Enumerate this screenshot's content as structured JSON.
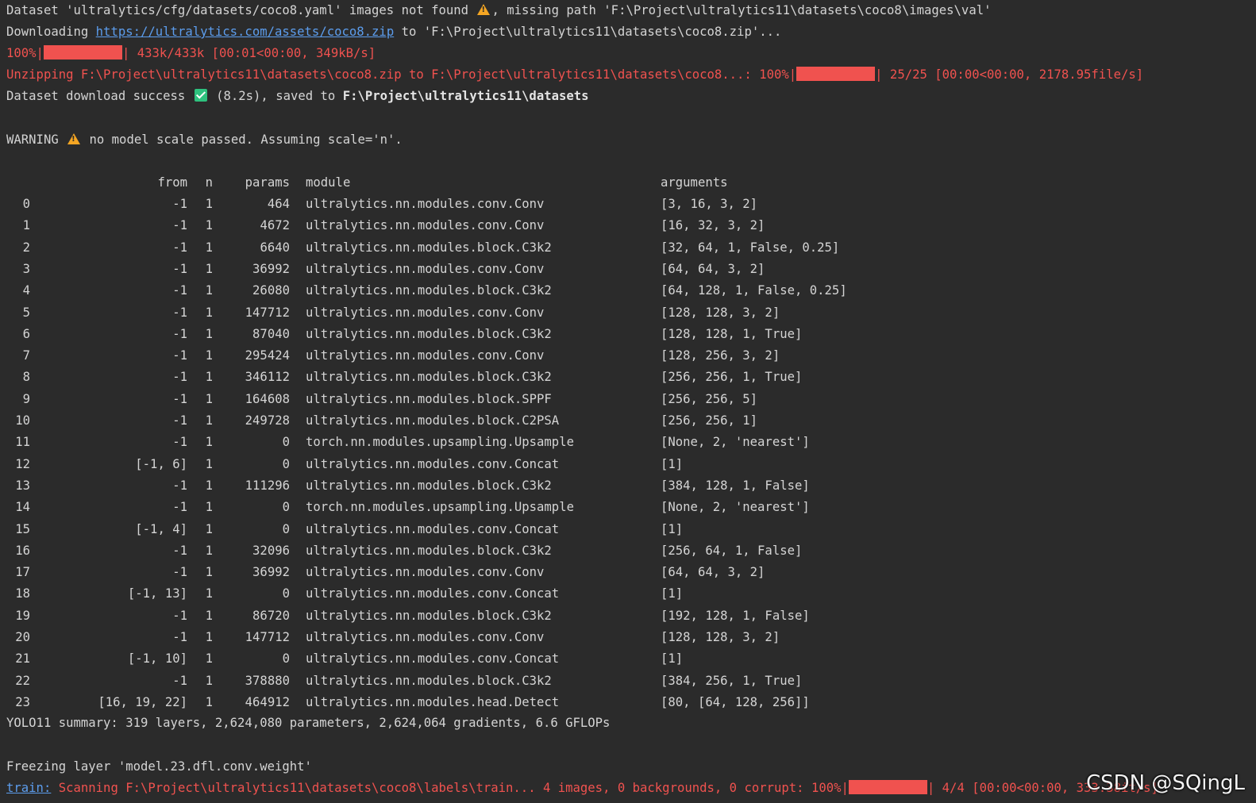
{
  "log": {
    "l1_a": "Dataset 'ultralytics/cfg/datasets/coco8.yaml' images not found ",
    "l1_icon": "warning-icon",
    "l1_b": ", missing path 'F:\\Project\\ultralytics11\\datasets\\coco8\\images\\val'",
    "l2_a": "Downloading ",
    "l2_link": "https://ultralytics.com/assets/coco8.zip",
    "l2_b": " to 'F:\\Project\\ultralytics11\\datasets\\coco8.zip'...",
    "l3_a": "100%|",
    "l3_progress": 100,
    "l3_b": "| 433k/433k [00:01<00:00, 349kB/s]",
    "l4_a": "Unzipping F:\\Project\\ultralytics11\\datasets\\coco8.zip to F:\\Project\\ultralytics11\\datasets\\coco8...: 100%|",
    "l4_progress": 100,
    "l4_b": "| 25/25 [00:00<00:00, 2178.95file/s]",
    "l5_a": "Dataset download success ",
    "l5_icon": "check-icon",
    "l5_b": " (8.2s), saved to ",
    "l5_path": "F:\\Project\\ultralytics11\\datasets",
    "l6_a": "WARNING ",
    "l6_icon": "warning-icon",
    "l6_b": " no model scale passed. Assuming scale='n'."
  },
  "table": {
    "headers": {
      "from": "from",
      "n": "n",
      "params": "params",
      "module": "module",
      "arguments": "arguments"
    },
    "rows": [
      {
        "idx": "0",
        "from": "-1",
        "n": "1",
        "params": "464",
        "module": "ultralytics.nn.modules.conv.Conv",
        "args": "[3, 16, 3, 2]"
      },
      {
        "idx": "1",
        "from": "-1",
        "n": "1",
        "params": "4672",
        "module": "ultralytics.nn.modules.conv.Conv",
        "args": "[16, 32, 3, 2]"
      },
      {
        "idx": "2",
        "from": "-1",
        "n": "1",
        "params": "6640",
        "module": "ultralytics.nn.modules.block.C3k2",
        "args": "[32, 64, 1, False, 0.25]"
      },
      {
        "idx": "3",
        "from": "-1",
        "n": "1",
        "params": "36992",
        "module": "ultralytics.nn.modules.conv.Conv",
        "args": "[64, 64, 3, 2]"
      },
      {
        "idx": "4",
        "from": "-1",
        "n": "1",
        "params": "26080",
        "module": "ultralytics.nn.modules.block.C3k2",
        "args": "[64, 128, 1, False, 0.25]"
      },
      {
        "idx": "5",
        "from": "-1",
        "n": "1",
        "params": "147712",
        "module": "ultralytics.nn.modules.conv.Conv",
        "args": "[128, 128, 3, 2]"
      },
      {
        "idx": "6",
        "from": "-1",
        "n": "1",
        "params": "87040",
        "module": "ultralytics.nn.modules.block.C3k2",
        "args": "[128, 128, 1, True]"
      },
      {
        "idx": "7",
        "from": "-1",
        "n": "1",
        "params": "295424",
        "module": "ultralytics.nn.modules.conv.Conv",
        "args": "[128, 256, 3, 2]"
      },
      {
        "idx": "8",
        "from": "-1",
        "n": "1",
        "params": "346112",
        "module": "ultralytics.nn.modules.block.C3k2",
        "args": "[256, 256, 1, True]"
      },
      {
        "idx": "9",
        "from": "-1",
        "n": "1",
        "params": "164608",
        "module": "ultralytics.nn.modules.block.SPPF",
        "args": "[256, 256, 5]"
      },
      {
        "idx": "10",
        "from": "-1",
        "n": "1",
        "params": "249728",
        "module": "ultralytics.nn.modules.block.C2PSA",
        "args": "[256, 256, 1]"
      },
      {
        "idx": "11",
        "from": "-1",
        "n": "1",
        "params": "0",
        "module": "torch.nn.modules.upsampling.Upsample",
        "args": "[None, 2, 'nearest']"
      },
      {
        "idx": "12",
        "from": "[-1, 6]",
        "n": "1",
        "params": "0",
        "module": "ultralytics.nn.modules.conv.Concat",
        "args": "[1]"
      },
      {
        "idx": "13",
        "from": "-1",
        "n": "1",
        "params": "111296",
        "module": "ultralytics.nn.modules.block.C3k2",
        "args": "[384, 128, 1, False]"
      },
      {
        "idx": "14",
        "from": "-1",
        "n": "1",
        "params": "0",
        "module": "torch.nn.modules.upsampling.Upsample",
        "args": "[None, 2, 'nearest']"
      },
      {
        "idx": "15",
        "from": "[-1, 4]",
        "n": "1",
        "params": "0",
        "module": "ultralytics.nn.modules.conv.Concat",
        "args": "[1]"
      },
      {
        "idx": "16",
        "from": "-1",
        "n": "1",
        "params": "32096",
        "module": "ultralytics.nn.modules.block.C3k2",
        "args": "[256, 64, 1, False]"
      },
      {
        "idx": "17",
        "from": "-1",
        "n": "1",
        "params": "36992",
        "module": "ultralytics.nn.modules.conv.Conv",
        "args": "[64, 64, 3, 2]"
      },
      {
        "idx": "18",
        "from": "[-1, 13]",
        "n": "1",
        "params": "0",
        "module": "ultralytics.nn.modules.conv.Concat",
        "args": "[1]"
      },
      {
        "idx": "19",
        "from": "-1",
        "n": "1",
        "params": "86720",
        "module": "ultralytics.nn.modules.block.C3k2",
        "args": "[192, 128, 1, False]"
      },
      {
        "idx": "20",
        "from": "-1",
        "n": "1",
        "params": "147712",
        "module": "ultralytics.nn.modules.conv.Conv",
        "args": "[128, 128, 3, 2]"
      },
      {
        "idx": "21",
        "from": "[-1, 10]",
        "n": "1",
        "params": "0",
        "module": "ultralytics.nn.modules.conv.Concat",
        "args": "[1]"
      },
      {
        "idx": "22",
        "from": "-1",
        "n": "1",
        "params": "378880",
        "module": "ultralytics.nn.modules.block.C3k2",
        "args": "[384, 256, 1, True]"
      },
      {
        "idx": "23",
        "from": "[16, 19, 22]",
        "n": "1",
        "params": "464912",
        "module": "ultralytics.nn.modules.head.Detect",
        "args": "[80, [64, 128, 256]]"
      }
    ]
  },
  "summary": "YOLO11 summary: 319 layers, 2,624,080 parameters, 2,624,064 gradients, 6.6 GFLOPs",
  "freezing": "Freezing layer 'model.23.dfl.conv.weight'",
  "train_line": {
    "tag": "train:",
    "a": " Scanning F:\\Project\\ultralytics11\\datasets\\coco8\\labels\\train... 4 images, 0 backgrounds, 0 corrupt: 100%|",
    "progress": 100,
    "b": "| 4/4 [00:00<00:00, 333.38it/s]"
  },
  "watermark": "CSDN @SQingL",
  "colors": {
    "background": "#2b2b2b",
    "text": "#d4d4d4",
    "error_red": "#f0524f",
    "link_blue": "#5c9ded",
    "success_green": "#2ec27e",
    "warning_yellow": "#f5a623"
  }
}
